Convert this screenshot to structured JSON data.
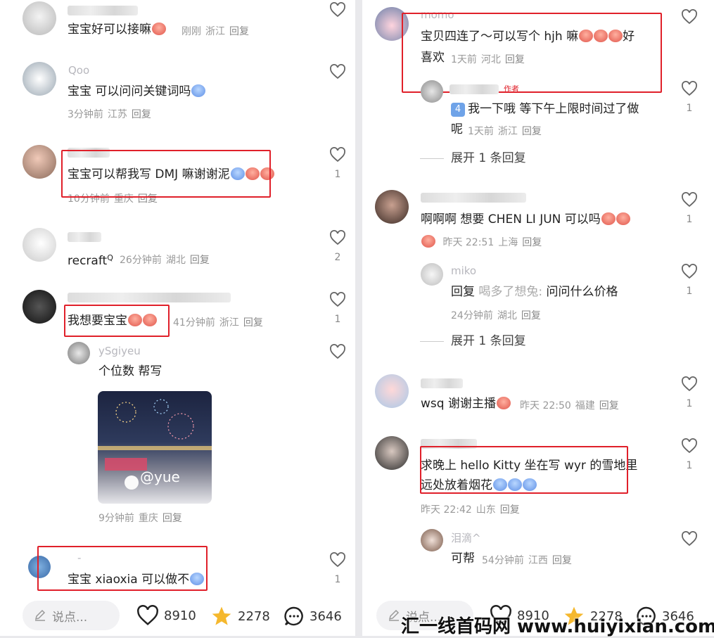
{
  "left": {
    "comments": [
      {
        "name": "",
        "text": "宝宝好可以接嘛",
        "time": "刚刚",
        "region": "浙江",
        "reply": "回复",
        "likes": ""
      },
      {
        "name": "Qoo",
        "text": "宝宝 可以问问关键词吗",
        "time": "3分钟前",
        "region": "江苏",
        "reply": "回复",
        "likes": ""
      },
      {
        "name": "",
        "text": "宝宝可以帮我写 DMJ 嘛谢谢泥",
        "time": "10分钟前",
        "region": "重庆",
        "reply": "回复",
        "likes": "1"
      },
      {
        "name": "",
        "text": "recraft",
        "time": "26分钟前",
        "region": "湖北",
        "reply": "回复",
        "likes": "2"
      },
      {
        "name": "",
        "text": "我想要宝宝",
        "time": "41分钟前",
        "region": "浙江",
        "reply": "回复",
        "likes": "1"
      },
      {
        "name": "ySgiyeu",
        "text": "个位数 帮写",
        "time": "9分钟前",
        "region": "重庆",
        "reply": "回复",
        "likes": ""
      },
      {
        "name": "-",
        "text": "宝宝 xiaoxia 可以做不",
        "time": "",
        "region": "",
        "reply": "",
        "likes": "1"
      }
    ],
    "photo_caption": "@yue",
    "bottom": {
      "placeholder": "说点...",
      "likes": "8910",
      "stars": "2278",
      "comments": "3646"
    }
  },
  "right": {
    "comments": [
      {
        "name": "momo",
        "text1": "宝贝四连了～可以写个 hjh 嘛",
        "text1b": "好",
        "text2": "喜欢",
        "time": "1天前",
        "region": "河北",
        "reply": "回复",
        "likes": ""
      },
      {
        "name": "",
        "author_tag": "作者",
        "badge": "4",
        "text1": "我一下哦 等下午上限时间过了做",
        "text2": "呢",
        "time": "1天前",
        "region": "浙江",
        "reply": "回复",
        "likes": "1"
      },
      {
        "name": "",
        "text": "啊啊啊 想要 CHEN LI JUN 可以吗",
        "time": "昨天 22:51",
        "region": "上海",
        "reply": "回复",
        "likes": "1"
      },
      {
        "name": "miko",
        "text_prefix": "回复",
        "text_quote": "喝多了想兔:",
        "text": "问问什么价格",
        "time": "24分钟前",
        "region": "湖北",
        "reply": "回复",
        "likes": "1"
      },
      {
        "name": "",
        "text": "wsq 谢谢主播",
        "time": "昨天 22:50",
        "region": "福建",
        "reply": "回复",
        "likes": "1"
      },
      {
        "name": "",
        "text1": "求晚上 hello Kitty 坐在写 wyr 的雪地里",
        "text2": "远处放着烟花",
        "time": "昨天 22:42",
        "region": "山东",
        "reply": "回复",
        "likes": "1"
      },
      {
        "name": "泪滴^",
        "text": "可帮",
        "time": "54分钟前",
        "region": "江西",
        "reply": "回复",
        "likes": ""
      }
    ],
    "expand1": "展开 1 条回复",
    "expand2": "展开 1 条回复",
    "bottom": {
      "placeholder": "说点...",
      "likes": "8910",
      "stars": "2278",
      "comments": "3646"
    }
  },
  "watermark": "汇一线首码网 www.huiyixian.com",
  "colors": {
    "highlight": "#e0202a",
    "star": "#f5b82e",
    "meta": "#999999"
  }
}
